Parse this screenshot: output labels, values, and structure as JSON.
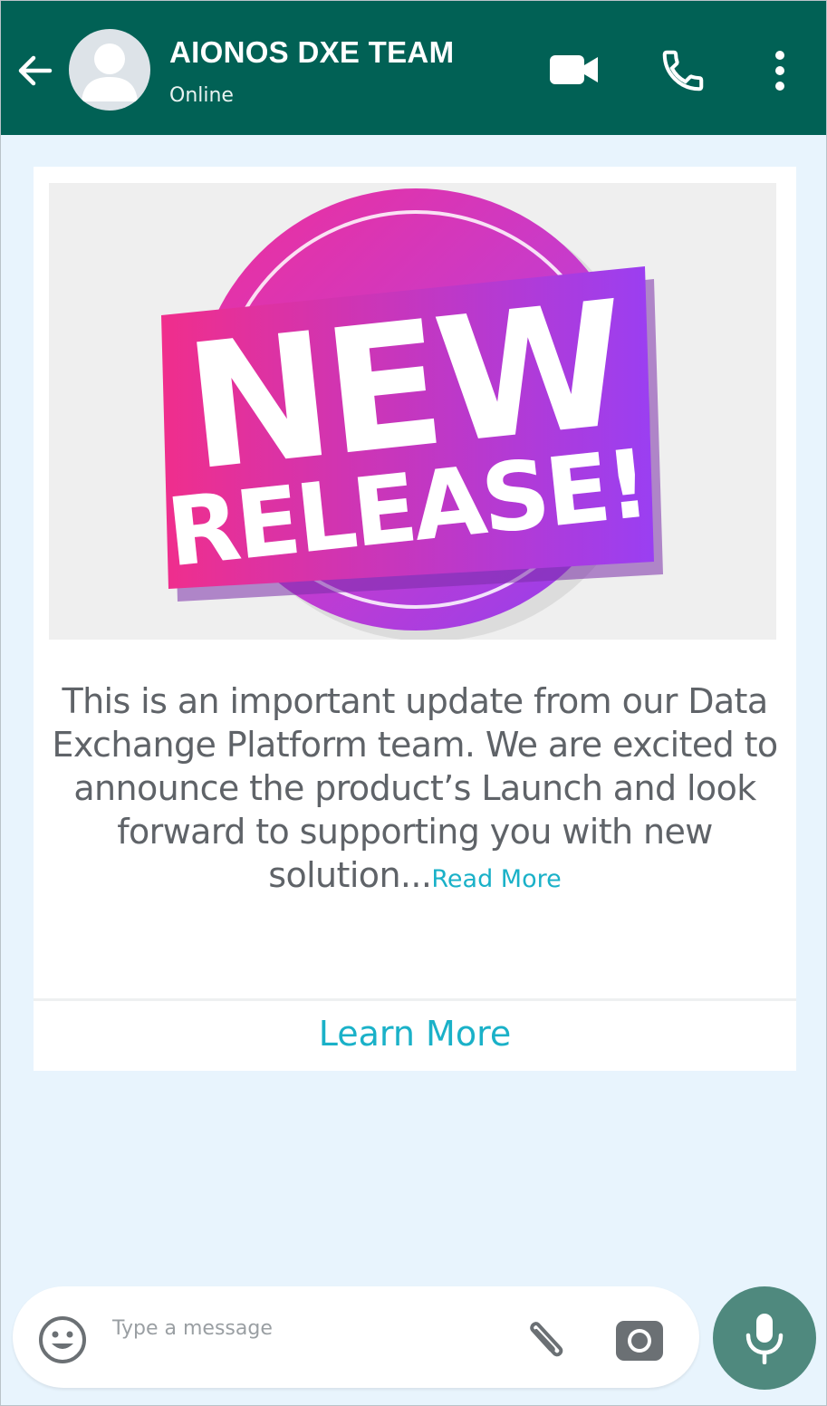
{
  "header": {
    "contact_name": "AIONOS DXE TEAM",
    "status": "Online",
    "background_color": "#016155",
    "icons": [
      "back-arrow-icon",
      "avatar-icon",
      "video-call-icon",
      "phone-icon",
      "more-vertical-icon"
    ]
  },
  "message": {
    "banner": {
      "line1": "NEW",
      "line2": "RELEASE!"
    },
    "body_text": "This is an important update from our Data Exchange Platform team. We are excited to announce the product’s Launch and look forward to supporting you with new solution...",
    "read_more_label": "Read More",
    "cta_label": "Learn More",
    "accent_color": "#1ab1c8"
  },
  "composer": {
    "placeholder": "Type a message",
    "value": "",
    "icons": [
      "emoji-icon",
      "attach-icon",
      "camera-icon",
      "mic-icon"
    ],
    "mic_color": "#4f897e"
  }
}
